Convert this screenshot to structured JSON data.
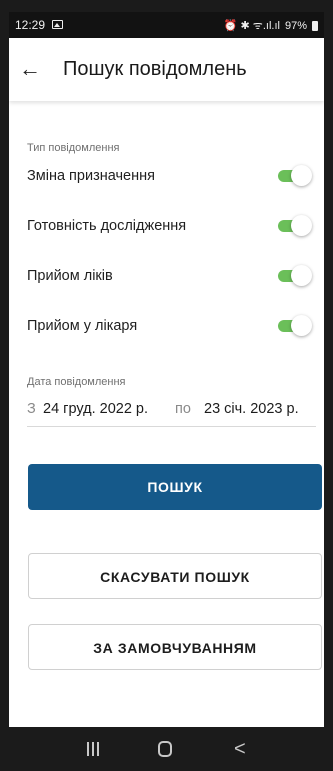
{
  "status_bar": {
    "time": "12:29",
    "indicators": "⏰ ✱ ᯤ.ıl.ıl",
    "battery": "97%"
  },
  "app_bar": {
    "back_icon": "arrow-left-icon",
    "title": "Пошук повідомлень"
  },
  "filters": {
    "type_label": "Тип повідомлення",
    "items": [
      {
        "label": "Зміна призначення",
        "enabled": true
      },
      {
        "label": "Готовність дослідження",
        "enabled": true
      },
      {
        "label": "Прийом ліків",
        "enabled": true
      },
      {
        "label": "Прийом у лікаря",
        "enabled": true
      }
    ],
    "toggle_color": "#6bbf59"
  },
  "date": {
    "label": "Дата повідомлення",
    "from_prefix": "З",
    "from_value": "24 груд. 2022 р.",
    "to_prefix": "по",
    "to_value": "23 січ. 2023 р."
  },
  "buttons": {
    "search": "ПОШУК",
    "cancel_search": "СКАСУВАТИ ПОШУК",
    "default": "ЗА ЗАМОВЧУВАННЯМ"
  },
  "colors": {
    "primary": "#15598a",
    "toggle_on": "#6bbf59"
  },
  "nav_bar": {
    "recents_icon": "recents-icon",
    "home_icon": "home-icon",
    "back_icon": "back-chevron-icon",
    "back_glyph": "<"
  }
}
